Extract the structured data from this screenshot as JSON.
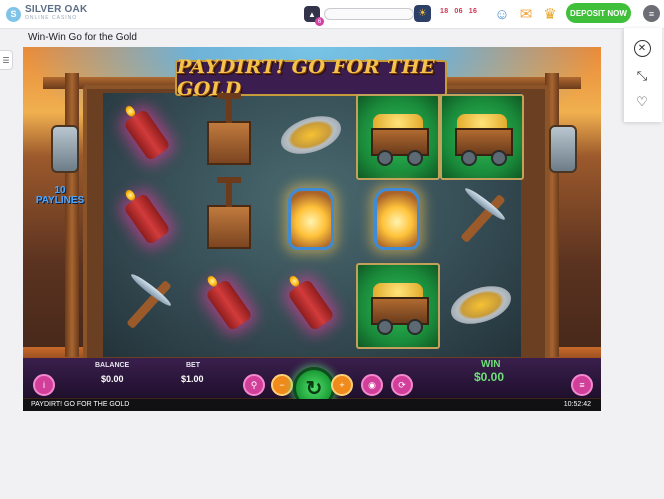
{
  "header": {
    "logo_mark": "S",
    "logo_name": "SILVER OAK",
    "logo_sub": "ONLINE CASINO",
    "level_icon": "level-icon",
    "level_number": "6",
    "progress_fraction": 0.0,
    "timer_icon": "☀",
    "timer_hours": "18",
    "timer_minutes": "06",
    "timer_seconds": "16",
    "icons": [
      "support-icon",
      "mail-icon",
      "trophy-icon"
    ],
    "deposit_label": "DEPOSIT NOW",
    "menu_icon": "menu-icon"
  },
  "page": {
    "game_title": "Win-Win Go for the Gold"
  },
  "side_panel": {
    "buttons": [
      "close-icon",
      "fullscreen-icon",
      "favorite-icon"
    ]
  },
  "game": {
    "title": "PAYDIRT! GO FOR THE GOLD",
    "paylines_count": "10",
    "paylines_label": "PAYLINES",
    "reels": [
      [
        "dynamite",
        "dynamite",
        "pickaxe"
      ],
      [
        "tnt-plunger",
        "tnt-plunger",
        "dynamite"
      ],
      [
        "gold-pan",
        "lantern",
        "dynamite"
      ],
      [
        "gold-cart",
        "lantern",
        "gold-cart"
      ],
      [
        "gold-cart",
        "pickaxe",
        "gold-pan"
      ]
    ],
    "controls": {
      "info_icon": "i",
      "balance_label": "BALANCE",
      "balance_value": "$0.00",
      "bet_label": "BET",
      "bet_value": "$1.00",
      "spin_icon": "↻",
      "win_label": "WIN",
      "win_value": "$0.00",
      "menu_icon": "≡"
    },
    "footer_name": "PAYDIRT! GO FOR THE GOLD",
    "footer_clock": "10:52:42"
  },
  "colors": {
    "deposit_green": "#3fbf3a",
    "timer_red": "#d2324f",
    "panel_purple": "#3a1f4d",
    "win_green": "#6fe07a"
  }
}
